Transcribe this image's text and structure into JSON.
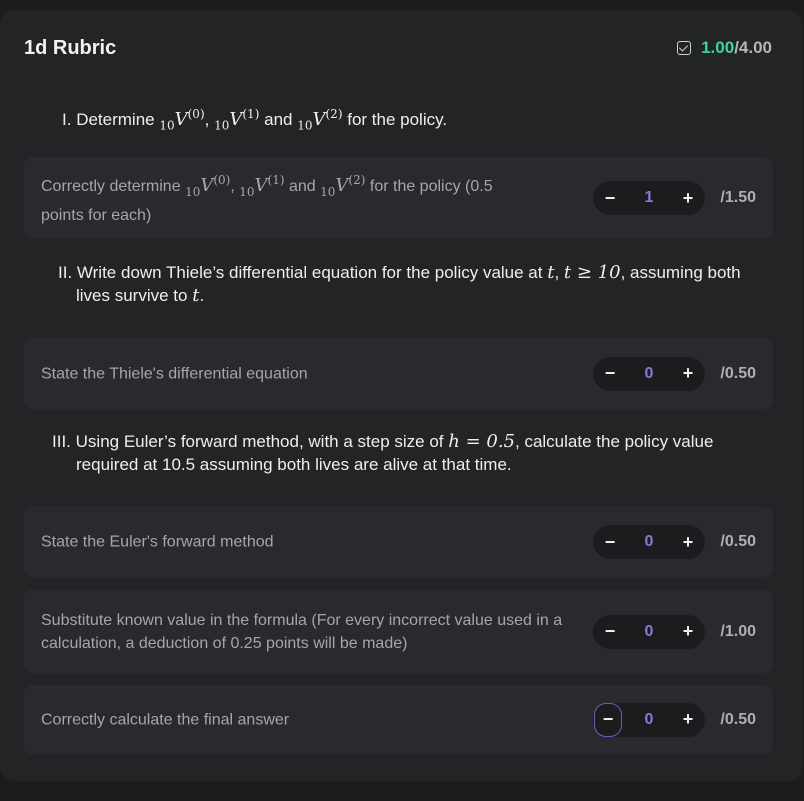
{
  "header": {
    "title": "1d Rubric",
    "score_earned": "1.00",
    "score_total": "/4.00"
  },
  "questions": [
    {
      "number": "I.",
      "text_before": "Determine",
      "text_after": "for the policy.",
      "and": "and",
      "comma": ","
    },
    {
      "number": "II.",
      "line1": "Write down Thiele’s differential equation for the policy value at",
      "line1_tail": ", assuming both",
      "line2": "lives survive to"
    },
    {
      "number": "III.",
      "line1_a": "Using Euler’s forward method, with a step size of",
      "line1_b": ", calculate the policy value",
      "line2": "required at 10.5 assuming both lives are alive at that time."
    }
  ],
  "criteria": [
    {
      "text_before": "Correctly determine",
      "text_after": "for the policy (0.5",
      "text_line2": "points for each)",
      "and": "and",
      "comma": ",",
      "value": "1",
      "max": "/1.50"
    },
    {
      "text": "State the Thiele's differential equation",
      "value": "0",
      "max": "/0.50"
    },
    {
      "text": "State the Euler's forward method",
      "value": "0",
      "max": "/0.50"
    },
    {
      "text": "Substitute known value in the formula (For every incorrect value used in a calculation, a deduction of 0.25 points will be made)",
      "value": "0",
      "max": "/1.00"
    },
    {
      "text": "Correctly calculate the final answer",
      "value": "0",
      "max": "/0.50"
    }
  ],
  "math": {
    "sub10": "10",
    "V": "V",
    "sup0": "(0)",
    "sup1": "(1)",
    "sup2": "(2)",
    "t": "t",
    "t_ge": "t ≥ 10",
    "h_eq": "h = 0.5"
  },
  "icons": {
    "minus": "−",
    "plus": "+",
    "score_icon": "checkbox-icon"
  },
  "colors": {
    "accent_green": "#37d6a2",
    "accent_purple": "#8a79d6"
  }
}
